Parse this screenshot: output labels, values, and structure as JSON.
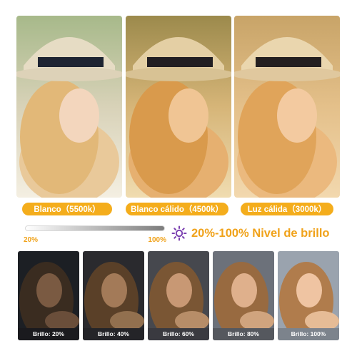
{
  "color_modes": [
    {
      "label": "Blanco（5500k）",
      "tint": "#f4f0e6"
    },
    {
      "label": "Blanco cálido（4500k）",
      "tint": "#f2d9a4"
    },
    {
      "label": "Luz cálida（3000k）",
      "tint": "#f1c98a"
    }
  ],
  "accent_color": "#f4ad1c",
  "brightness_slider": {
    "min_label": "20%",
    "max_label": "100%",
    "icon": "sun-brightness-icon"
  },
  "brightness_title": "20%-100% Nivel de brillo",
  "brightness_levels": [
    {
      "label": "Brillo: 20%",
      "level": 0.2
    },
    {
      "label": "Brillo: 40%",
      "level": 0.4
    },
    {
      "label": "Brillo: 60%",
      "level": 0.6
    },
    {
      "label": "Brillo: 80%",
      "level": 0.8
    },
    {
      "label": "Brillo: 100%",
      "level": 1.0
    }
  ]
}
